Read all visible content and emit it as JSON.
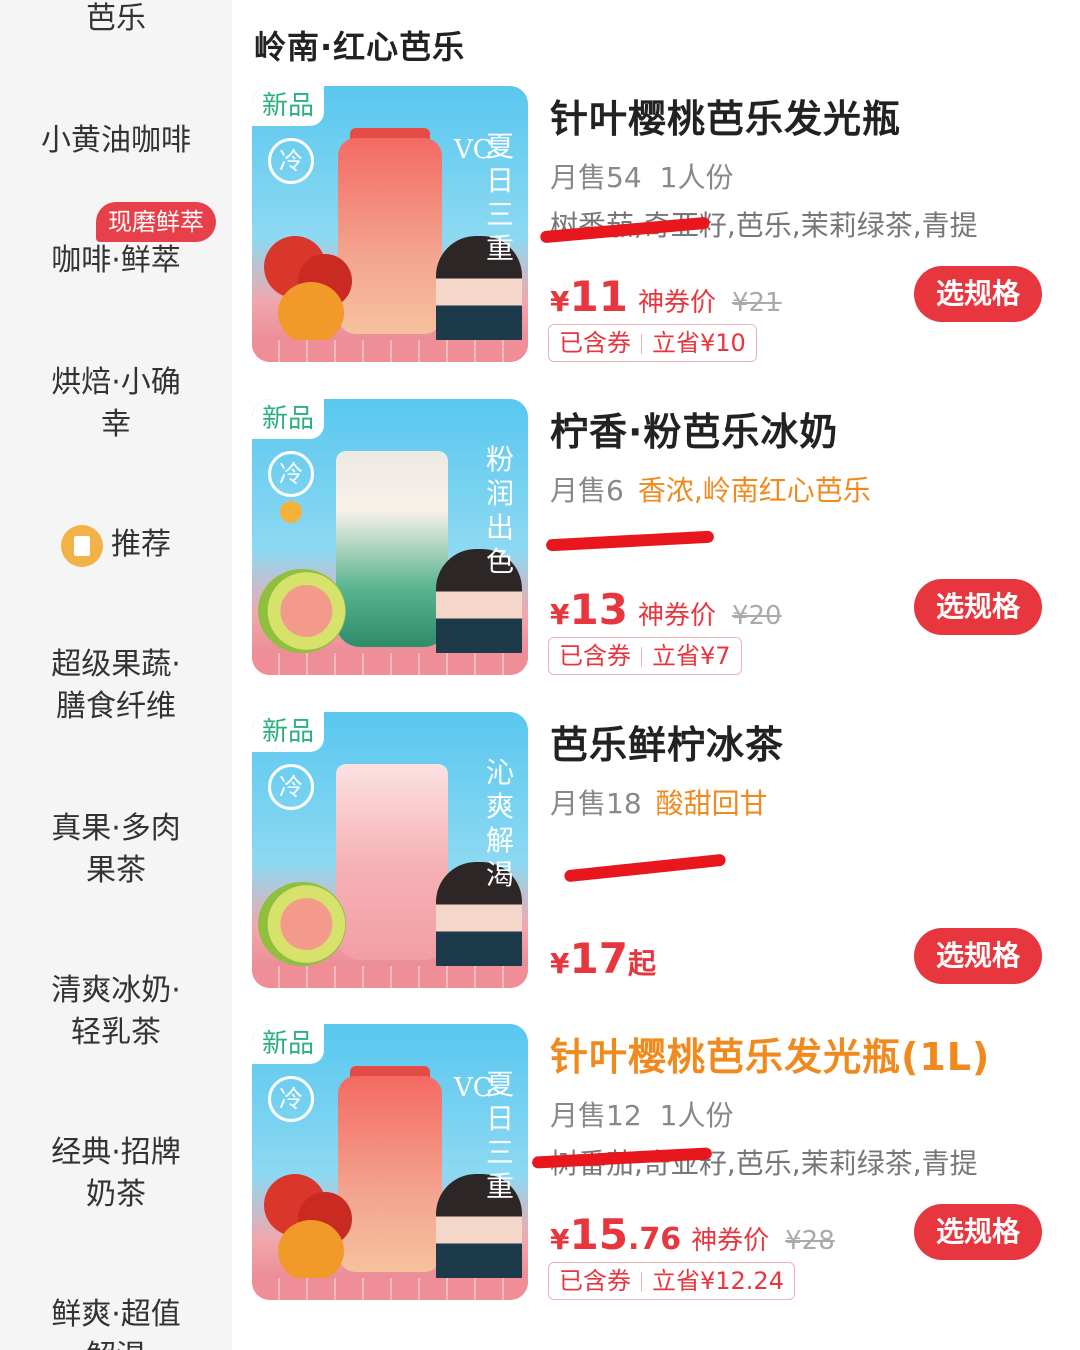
{
  "sidebar": {
    "items": [
      {
        "lines": [
          "芭乐"
        ]
      },
      {
        "lines": [
          "小黄油咖啡"
        ]
      },
      {
        "lines": [
          "咖啡·鲜萃"
        ],
        "badge": "现磨鲜萃"
      },
      {
        "lines": [
          "烘焙·小确",
          "幸"
        ]
      },
      {
        "lines": [
          "推荐"
        ],
        "icon": "recommend-bookmark-icon"
      },
      {
        "lines": [
          "超级果蔬·",
          "膳食纤维"
        ]
      },
      {
        "lines": [
          "真果·多肉",
          "果茶"
        ]
      },
      {
        "lines": [
          "清爽冰奶·",
          "轻乳茶"
        ]
      },
      {
        "lines": [
          "经典·招牌",
          "奶茶"
        ]
      },
      {
        "lines": [
          "鲜爽·超值",
          "解渴"
        ]
      }
    ]
  },
  "section_title": "岭南·红心芭乐",
  "products": [
    {
      "new_tag": "新品",
      "cold_label": "冷",
      "image_text_main": "夏日三重",
      "image_text_side": "VC",
      "name": "针叶樱桃芭乐发光瓶",
      "monthly_sales": "月售54",
      "serving": "1人份",
      "description": "树番茄,奇亚籽,芭乐,茉莉绿茶,青提",
      "currency": "¥",
      "price_int": "11",
      "price_dec": "",
      "price_label": "神券价",
      "original_price": "¥21",
      "coupon_included": "已含券",
      "coupon_saved": "立省¥10",
      "button": "选规格"
    },
    {
      "new_tag": "新品",
      "cold_label": "冷",
      "image_text_main": "粉润出色",
      "name": "柠香·粉芭乐冰奶",
      "monthly_sales": "月售6",
      "tags": "香浓,岭南红心芭乐",
      "currency": "¥",
      "price_int": "13",
      "price_label": "神券价",
      "original_price": "¥20",
      "coupon_included": "已含券",
      "coupon_saved": "立省¥7",
      "button": "选规格"
    },
    {
      "new_tag": "新品",
      "cold_label": "冷",
      "image_text_main": "沁爽解渴",
      "name": "芭乐鲜柠冰茶",
      "monthly_sales": "月售18",
      "tags": "酸甜回甘",
      "currency": "¥",
      "price_int": "17",
      "price_suffix": "起",
      "button": "选规格"
    },
    {
      "new_tag": "新品",
      "cold_label": "冷",
      "image_text_main": "夏日三重",
      "image_text_side": "VC",
      "name": "针叶樱桃芭乐发光瓶(1L)",
      "monthly_sales": "月售12",
      "serving": "1人份",
      "description": "树番茄,奇亚籽,芭乐,茉莉绿茶,青提",
      "currency": "¥",
      "price_int": "15",
      "price_dec": ".76",
      "price_label": "神券价",
      "original_price": "¥28",
      "coupon_included": "已含券",
      "coupon_saved": "立省¥12.24",
      "button": "选规格"
    }
  ],
  "colors": {
    "accent_red": "#e8363e",
    "tag_orange": "#f08a1e",
    "scribble_red": "#e8171e",
    "sidebar_bg": "#f5f5f5"
  }
}
